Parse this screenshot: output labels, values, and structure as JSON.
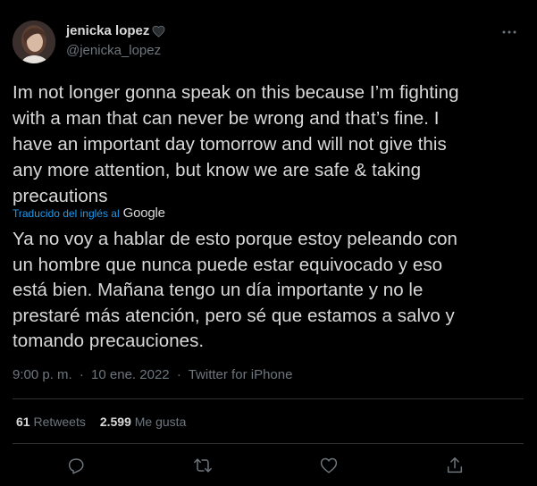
{
  "user": {
    "display_name": "jenicka lopez",
    "handle": "@jenicka_lopez"
  },
  "tweet": {
    "text": "Im not longer gonna speak on this because I’m fighting\nwith a man that can never be wrong and that’s fine. I\nhave an important day tomorrow and will not give this\nany more attention, but know we are safe & taking\nprecautions",
    "translation_label": "Traducido del inglés al",
    "translation_provider": "Google",
    "translated_text": "Ya no voy a hablar de esto porque estoy peleando con\nun hombre que nunca puede estar equivocado y eso\nestá bien. Mañana tengo un día importante y no le\nprestaré más atención, pero sé que estamos a salvo y\ntomando precauciones.",
    "time": "9:00 p. m.",
    "separator": "·",
    "date": "10 ene. 2022",
    "source": "Twitter for iPhone"
  },
  "stats": {
    "retweets_count": "61",
    "retweets_label": "Retweets",
    "likes_count": "2.599",
    "likes_label": "Me gusta"
  },
  "icons": {
    "more": "more-icon",
    "reply": "reply-icon",
    "retweet": "retweet-icon",
    "like": "like-icon",
    "share": "share-icon",
    "name_emoji": "black-heart-icon"
  },
  "colors": {
    "background": "#000000",
    "text": "#d9d9d9",
    "secondary": "#6e767d",
    "link": "#1d9bf0",
    "divider": "#2f3336"
  }
}
